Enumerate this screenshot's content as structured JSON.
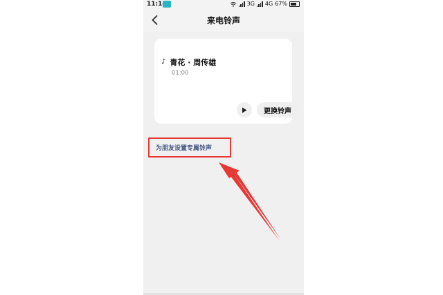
{
  "status_bar": {
    "time": "11:14",
    "network_1": "3G",
    "network_2": "4G",
    "battery": "67%"
  },
  "nav": {
    "title": "来电铃声",
    "back_icon": "chevron-left-icon"
  },
  "ringtone_card": {
    "note_icon": "♪",
    "song_title": "青花 · 周传雄",
    "duration": "01:00",
    "play_icon": "play-icon",
    "change_label": "更换铃声"
  },
  "friend_ringtone": {
    "label": "为朋友设置专属铃声"
  },
  "colors": {
    "annotation_red": "#e53935",
    "link_text": "#4a5b85",
    "page_bg": "#f0f0f0",
    "card_bg": "#ffffff",
    "status_icon_teal": "#29b6c4"
  }
}
